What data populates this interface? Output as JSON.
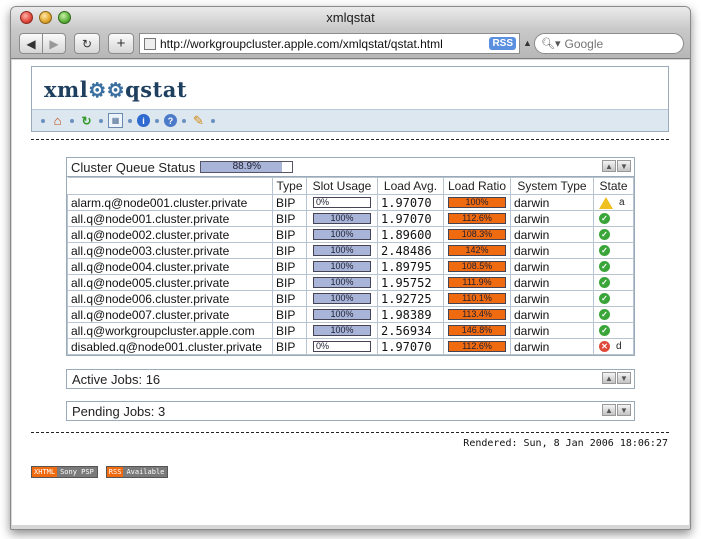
{
  "window": {
    "title": "xmlqstat"
  },
  "toolbar": {
    "back_icon": "back-arrow-icon",
    "forward_icon": "forward-arrow-icon",
    "url": "http://workgroupcluster.apple.com/xmlqstat/qstat.html",
    "rss_label": "RSS",
    "search_placeholder": "Google"
  },
  "page": {
    "logo": {
      "left": "xml",
      "right": "qstat"
    },
    "cluster_queue": {
      "title": "Cluster Queue Status",
      "usage_label": "88.9%",
      "usage_fraction": 0.889,
      "columns": [
        "Type",
        "Slot Usage",
        "Load Avg.",
        "Load Ratio",
        "System Type",
        "State"
      ],
      "rows": [
        {
          "name": "alarm.q@node001.cluster.private",
          "type": "BIP",
          "slot_label": "0%",
          "slot_fraction": 0,
          "load_avg": "1.97070",
          "load_ratio": "100%",
          "load_fraction": 1.0,
          "system": "darwin",
          "state": "warning",
          "flag": "a"
        },
        {
          "name": "all.q@node001.cluster.private",
          "type": "BIP",
          "slot_label": "100%",
          "slot_fraction": 1,
          "load_avg": "1.97070",
          "load_ratio": "112.6%",
          "load_fraction": 1.0,
          "system": "darwin",
          "state": "ok",
          "flag": ""
        },
        {
          "name": "all.q@node002.cluster.private",
          "type": "BIP",
          "slot_label": "100%",
          "slot_fraction": 1,
          "load_avg": "1.89600",
          "load_ratio": "108.3%",
          "load_fraction": 1.0,
          "system": "darwin",
          "state": "ok",
          "flag": ""
        },
        {
          "name": "all.q@node003.cluster.private",
          "type": "BIP",
          "slot_label": "100%",
          "slot_fraction": 1,
          "load_avg": "2.48486",
          "load_ratio": "142%",
          "load_fraction": 1.0,
          "system": "darwin",
          "state": "ok",
          "flag": ""
        },
        {
          "name": "all.q@node004.cluster.private",
          "type": "BIP",
          "slot_label": "100%",
          "slot_fraction": 1,
          "load_avg": "1.89795",
          "load_ratio": "108.5%",
          "load_fraction": 1.0,
          "system": "darwin",
          "state": "ok",
          "flag": ""
        },
        {
          "name": "all.q@node005.cluster.private",
          "type": "BIP",
          "slot_label": "100%",
          "slot_fraction": 1,
          "load_avg": "1.95752",
          "load_ratio": "111.9%",
          "load_fraction": 1.0,
          "system": "darwin",
          "state": "ok",
          "flag": ""
        },
        {
          "name": "all.q@node006.cluster.private",
          "type": "BIP",
          "slot_label": "100%",
          "slot_fraction": 1,
          "load_avg": "1.92725",
          "load_ratio": "110.1%",
          "load_fraction": 1.0,
          "system": "darwin",
          "state": "ok",
          "flag": ""
        },
        {
          "name": "all.q@node007.cluster.private",
          "type": "BIP",
          "slot_label": "100%",
          "slot_fraction": 1,
          "load_avg": "1.98389",
          "load_ratio": "113.4%",
          "load_fraction": 1.0,
          "system": "darwin",
          "state": "ok",
          "flag": ""
        },
        {
          "name": "all.q@workgroupcluster.apple.com",
          "type": "BIP",
          "slot_label": "100%",
          "slot_fraction": 1,
          "load_avg": "2.56934",
          "load_ratio": "146.8%",
          "load_fraction": 1.0,
          "system": "darwin",
          "state": "ok",
          "flag": ""
        },
        {
          "name": "disabled.q@node001.cluster.private",
          "type": "BIP",
          "slot_label": "0%",
          "slot_fraction": 0,
          "load_avg": "1.97070",
          "load_ratio": "112.6%",
          "load_fraction": 1.0,
          "system": "darwin",
          "state": "error",
          "flag": "d"
        }
      ]
    },
    "active_jobs": "Active Jobs: 16",
    "pending_jobs": "Pending Jobs: 3",
    "rendered": "Rendered: Sun, 8 Jan 2006 18:06:27",
    "badges": [
      {
        "left": "XHTML",
        "right": "Sony PSP"
      },
      {
        "left": "RSS",
        "right": "Available"
      }
    ]
  },
  "colors": {
    "slot_fill": "#a8b4d8",
    "load_fill": "#f06a10",
    "header_border": "#9aaab8"
  }
}
